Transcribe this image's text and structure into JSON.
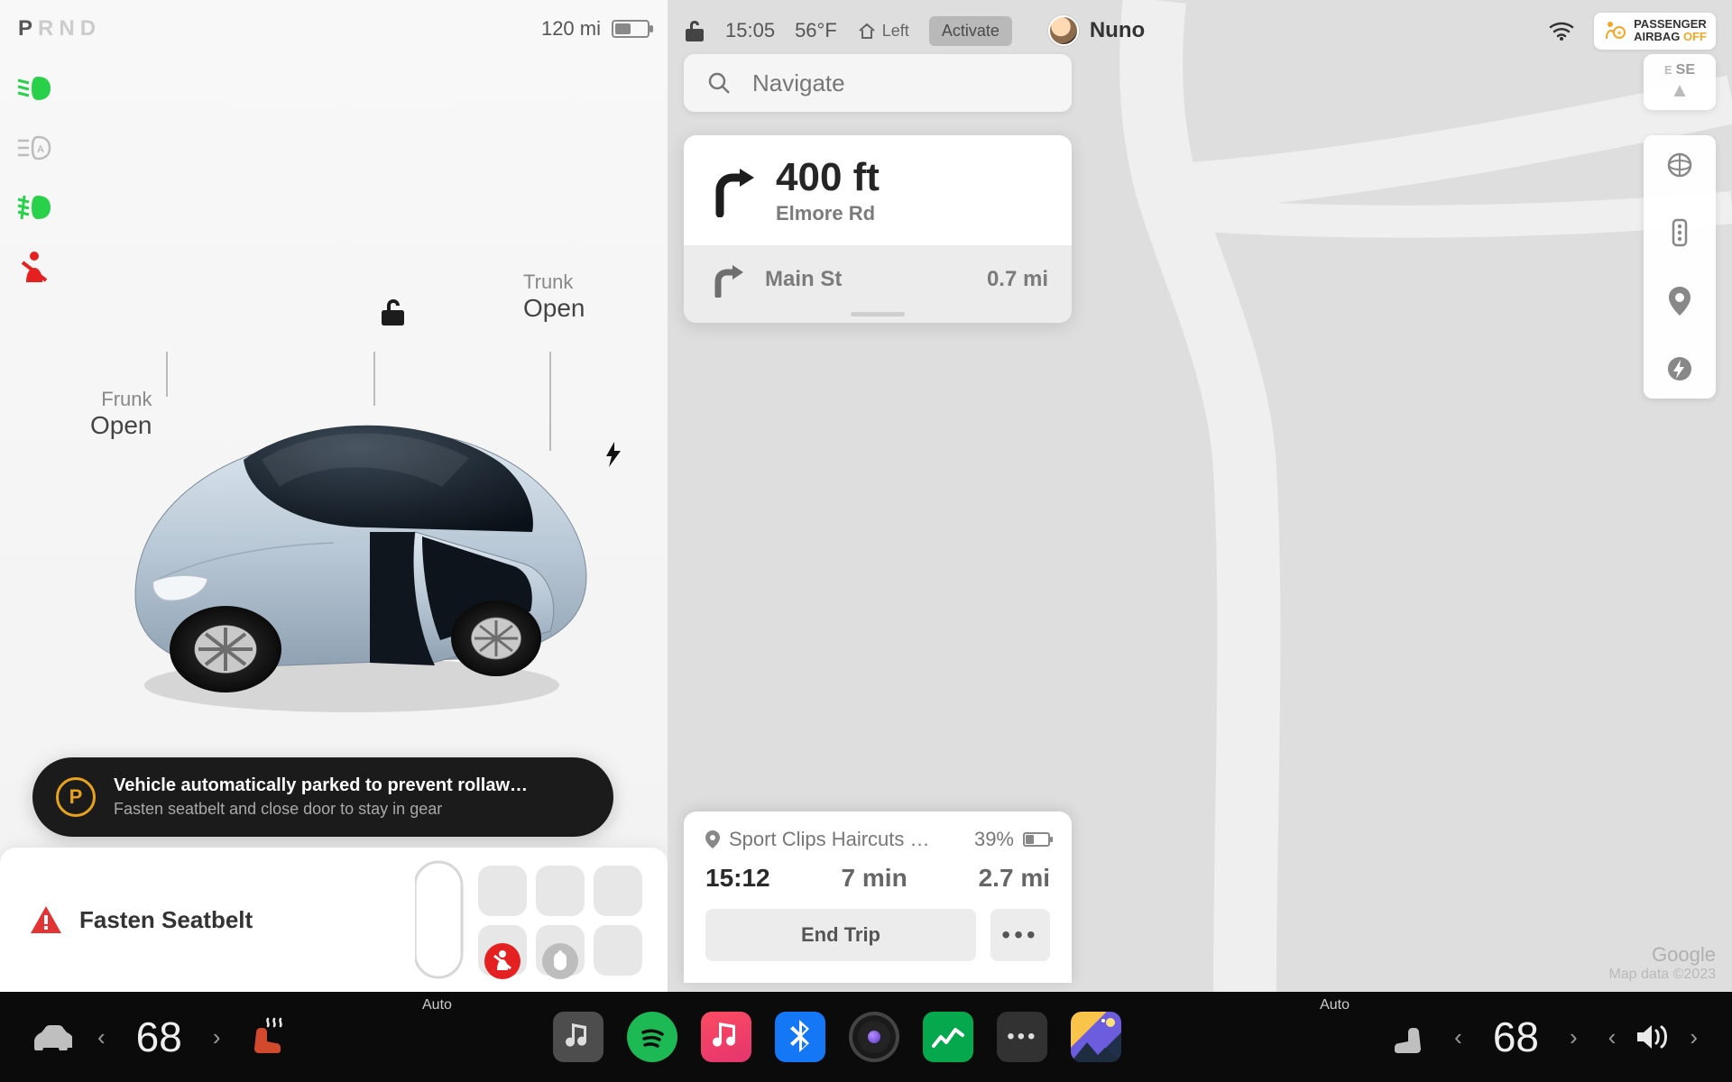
{
  "left": {
    "gears": [
      "P",
      "R",
      "N",
      "D"
    ],
    "active_gear": "P",
    "range": "120 mi",
    "battery_pct": 45,
    "telltales": {
      "headlight": "low-beam-on",
      "auto_high_beam": "auto-high-beam",
      "fog": "fog-light-on",
      "seatbelt": "seatbelt-warning"
    },
    "lock_state": "unlocked",
    "callouts": {
      "trunk_label": "Trunk",
      "trunk_state": "Open",
      "frunk_label": "Frunk",
      "frunk_state": "Open"
    },
    "charge_port": "plugged",
    "alert": {
      "badge": "P",
      "line1": "Vehicle automatically parked to prevent rollaw…",
      "line2": "Fasten seatbelt and close door to stay in gear"
    },
    "warning": {
      "text": "Fasten Seatbelt"
    }
  },
  "right": {
    "lock": "unlocked",
    "time": "15:05",
    "temp": "56°F",
    "homelink_label": "Left",
    "activate_label": "Activate",
    "driver_name": "Nuno",
    "airbag": {
      "line1": "PASSENGER",
      "line2": "AIRBAG",
      "state": "OFF"
    },
    "search_placeholder": "Navigate",
    "compass": {
      "e": "E",
      "se": "SE"
    },
    "turn": {
      "primary_distance": "400 ft",
      "primary_road": "Elmore Rd",
      "secondary_road": "Main St",
      "secondary_distance": "0.7 mi"
    },
    "destination": {
      "name": "Sport Clips Haircuts …",
      "soc_at_arrival": "39%",
      "eta_time": "15:12",
      "eta_duration": "7 min",
      "eta_distance": "2.7 mi",
      "end_trip_label": "End Trip"
    },
    "attrib": {
      "brand": "Google",
      "line": "Map data ©2023"
    },
    "tools": [
      "globe",
      "traffic",
      "pin",
      "supercharger"
    ]
  },
  "bottom": {
    "temp_left": "68",
    "temp_right": "68",
    "auto_label": "Auto",
    "apps": [
      "music",
      "spotify",
      "apple-music",
      "bluetooth",
      "dashcam",
      "stocks",
      "more",
      "wallpaper"
    ]
  }
}
